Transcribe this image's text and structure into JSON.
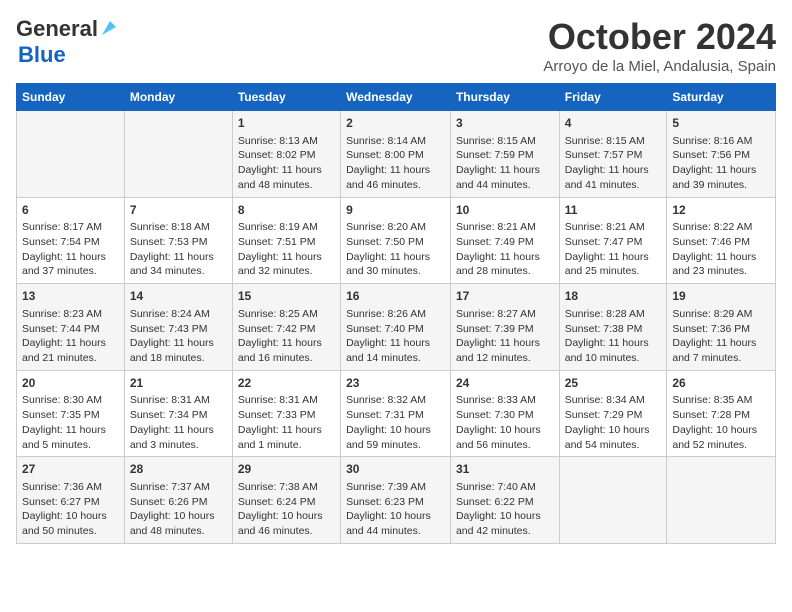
{
  "header": {
    "logo_line1": "General",
    "logo_line2": "Blue",
    "month": "October 2024",
    "location": "Arroyo de la Miel, Andalusia, Spain"
  },
  "days_of_week": [
    "Sunday",
    "Monday",
    "Tuesday",
    "Wednesday",
    "Thursday",
    "Friday",
    "Saturday"
  ],
  "weeks": [
    [
      {
        "day": "",
        "content": ""
      },
      {
        "day": "",
        "content": ""
      },
      {
        "day": "1",
        "content": "Sunrise: 8:13 AM\nSunset: 8:02 PM\nDaylight: 11 hours and 48 minutes."
      },
      {
        "day": "2",
        "content": "Sunrise: 8:14 AM\nSunset: 8:00 PM\nDaylight: 11 hours and 46 minutes."
      },
      {
        "day": "3",
        "content": "Sunrise: 8:15 AM\nSunset: 7:59 PM\nDaylight: 11 hours and 44 minutes."
      },
      {
        "day": "4",
        "content": "Sunrise: 8:15 AM\nSunset: 7:57 PM\nDaylight: 11 hours and 41 minutes."
      },
      {
        "day": "5",
        "content": "Sunrise: 8:16 AM\nSunset: 7:56 PM\nDaylight: 11 hours and 39 minutes."
      }
    ],
    [
      {
        "day": "6",
        "content": "Sunrise: 8:17 AM\nSunset: 7:54 PM\nDaylight: 11 hours and 37 minutes."
      },
      {
        "day": "7",
        "content": "Sunrise: 8:18 AM\nSunset: 7:53 PM\nDaylight: 11 hours and 34 minutes."
      },
      {
        "day": "8",
        "content": "Sunrise: 8:19 AM\nSunset: 7:51 PM\nDaylight: 11 hours and 32 minutes."
      },
      {
        "day": "9",
        "content": "Sunrise: 8:20 AM\nSunset: 7:50 PM\nDaylight: 11 hours and 30 minutes."
      },
      {
        "day": "10",
        "content": "Sunrise: 8:21 AM\nSunset: 7:49 PM\nDaylight: 11 hours and 28 minutes."
      },
      {
        "day": "11",
        "content": "Sunrise: 8:21 AM\nSunset: 7:47 PM\nDaylight: 11 hours and 25 minutes."
      },
      {
        "day": "12",
        "content": "Sunrise: 8:22 AM\nSunset: 7:46 PM\nDaylight: 11 hours and 23 minutes."
      }
    ],
    [
      {
        "day": "13",
        "content": "Sunrise: 8:23 AM\nSunset: 7:44 PM\nDaylight: 11 hours and 21 minutes."
      },
      {
        "day": "14",
        "content": "Sunrise: 8:24 AM\nSunset: 7:43 PM\nDaylight: 11 hours and 18 minutes."
      },
      {
        "day": "15",
        "content": "Sunrise: 8:25 AM\nSunset: 7:42 PM\nDaylight: 11 hours and 16 minutes."
      },
      {
        "day": "16",
        "content": "Sunrise: 8:26 AM\nSunset: 7:40 PM\nDaylight: 11 hours and 14 minutes."
      },
      {
        "day": "17",
        "content": "Sunrise: 8:27 AM\nSunset: 7:39 PM\nDaylight: 11 hours and 12 minutes."
      },
      {
        "day": "18",
        "content": "Sunrise: 8:28 AM\nSunset: 7:38 PM\nDaylight: 11 hours and 10 minutes."
      },
      {
        "day": "19",
        "content": "Sunrise: 8:29 AM\nSunset: 7:36 PM\nDaylight: 11 hours and 7 minutes."
      }
    ],
    [
      {
        "day": "20",
        "content": "Sunrise: 8:30 AM\nSunset: 7:35 PM\nDaylight: 11 hours and 5 minutes."
      },
      {
        "day": "21",
        "content": "Sunrise: 8:31 AM\nSunset: 7:34 PM\nDaylight: 11 hours and 3 minutes."
      },
      {
        "day": "22",
        "content": "Sunrise: 8:31 AM\nSunset: 7:33 PM\nDaylight: 11 hours and 1 minute."
      },
      {
        "day": "23",
        "content": "Sunrise: 8:32 AM\nSunset: 7:31 PM\nDaylight: 10 hours and 59 minutes."
      },
      {
        "day": "24",
        "content": "Sunrise: 8:33 AM\nSunset: 7:30 PM\nDaylight: 10 hours and 56 minutes."
      },
      {
        "day": "25",
        "content": "Sunrise: 8:34 AM\nSunset: 7:29 PM\nDaylight: 10 hours and 54 minutes."
      },
      {
        "day": "26",
        "content": "Sunrise: 8:35 AM\nSunset: 7:28 PM\nDaylight: 10 hours and 52 minutes."
      }
    ],
    [
      {
        "day": "27",
        "content": "Sunrise: 7:36 AM\nSunset: 6:27 PM\nDaylight: 10 hours and 50 minutes."
      },
      {
        "day": "28",
        "content": "Sunrise: 7:37 AM\nSunset: 6:26 PM\nDaylight: 10 hours and 48 minutes."
      },
      {
        "day": "29",
        "content": "Sunrise: 7:38 AM\nSunset: 6:24 PM\nDaylight: 10 hours and 46 minutes."
      },
      {
        "day": "30",
        "content": "Sunrise: 7:39 AM\nSunset: 6:23 PM\nDaylight: 10 hours and 44 minutes."
      },
      {
        "day": "31",
        "content": "Sunrise: 7:40 AM\nSunset: 6:22 PM\nDaylight: 10 hours and 42 minutes."
      },
      {
        "day": "",
        "content": ""
      },
      {
        "day": "",
        "content": ""
      }
    ]
  ]
}
